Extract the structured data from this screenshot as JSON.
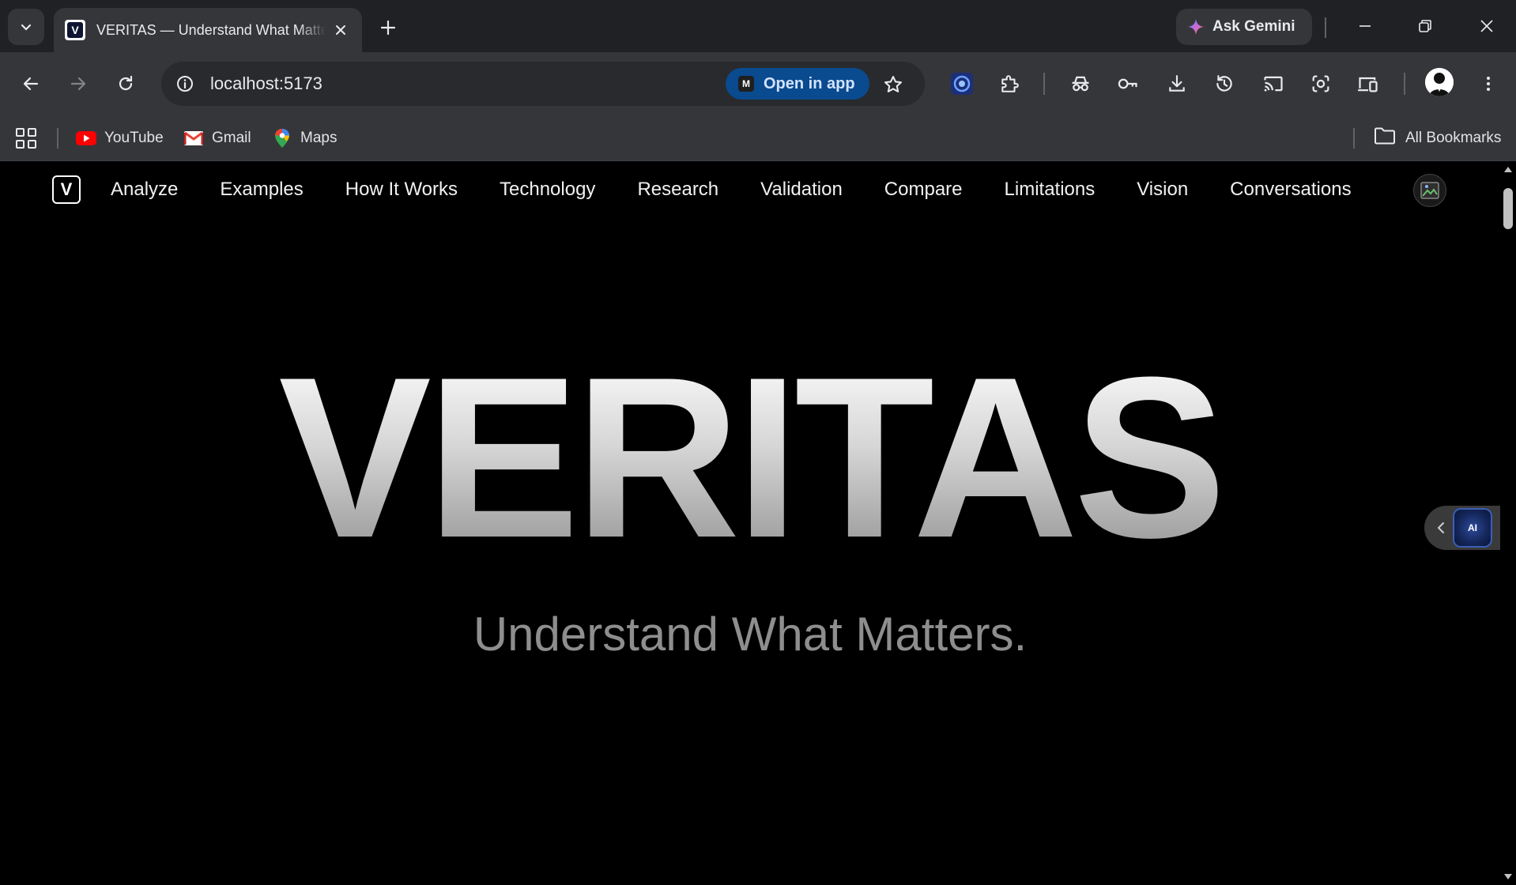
{
  "browser": {
    "tab_title": "VERITAS — Understand What Matters",
    "ask_gemini": "Ask Gemini",
    "url": "localhost:5173",
    "open_in_app": "Open in app",
    "open_in_app_badge": "M",
    "bookmarks": [
      {
        "label": "YouTube",
        "icon": "youtube-icon"
      },
      {
        "label": "Gmail",
        "icon": "gmail-icon"
      },
      {
        "label": "Maps",
        "icon": "maps-icon"
      }
    ],
    "all_bookmarks": "All Bookmarks"
  },
  "site": {
    "logo_letter": "V",
    "nav": [
      "Analyze",
      "Examples",
      "How It Works",
      "Technology",
      "Research",
      "Validation",
      "Compare",
      "Limitations",
      "Vision",
      "Conversations"
    ],
    "hero_title": "VERITAS",
    "hero_subtitle": "Understand What Matters.",
    "ai_badge": "AI"
  },
  "colors": {
    "chrome_dark": "#202124",
    "chrome_toolbar": "#35363a",
    "page_bg": "#000000",
    "open_in_app_bg": "#0a4a8f",
    "subtitle": "#8e8e8e"
  }
}
